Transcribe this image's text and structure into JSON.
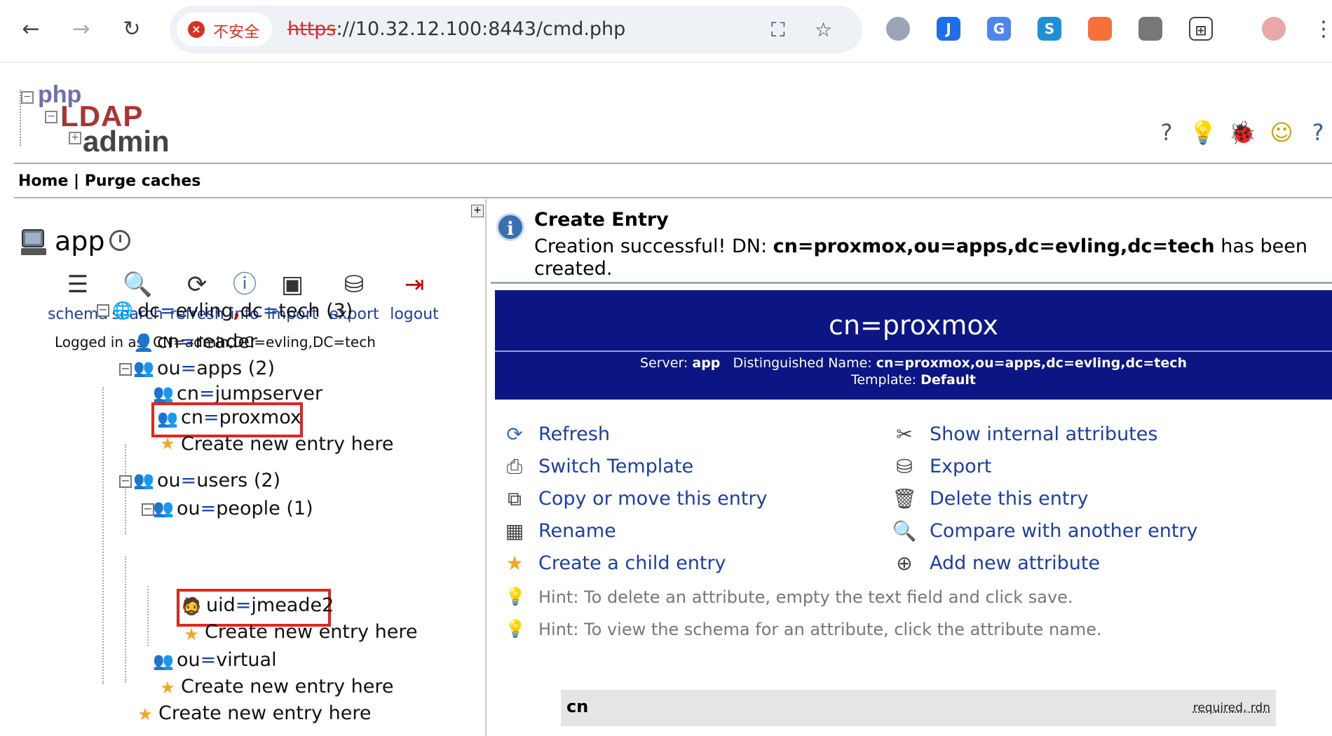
{
  "browser": {
    "insecure_label": "不安全",
    "url_scheme": "https",
    "url_rest": "://10.32.12.100:8443/cmd.php"
  },
  "header": {
    "logo_php": "php",
    "logo_ldap": "LDAP",
    "logo_admin": "admin",
    "home": "Home",
    "separator": "|",
    "purge": "Purge caches"
  },
  "sidebar": {
    "server": "app",
    "tools": [
      "schema",
      "search",
      "refresh",
      "info",
      "import",
      "export",
      "logout"
    ],
    "logged_in": "Logged in as: CN=admin,DC=evling,DC=tech",
    "tree": {
      "root": {
        "a": "dc",
        "b": "evling",
        "c": "dc",
        "d": "tech",
        "count": "(3)"
      },
      "reader": {
        "k": "cn",
        "v": "reader"
      },
      "apps": {
        "k": "ou",
        "v": "apps",
        "count": "(2)"
      },
      "jumpserver": {
        "k": "cn",
        "v": "jumpserver"
      },
      "proxmox": {
        "k": "cn",
        "v": "proxmox"
      },
      "create": "Create new entry here",
      "users": {
        "k": "ou",
        "v": "users",
        "count": "(2)"
      },
      "people": {
        "k": "ou",
        "v": "people",
        "count": "(1)"
      },
      "jmeade": {
        "k": "uid",
        "v": "jmeade2"
      },
      "virtual": {
        "k": "ou",
        "v": "virtual"
      }
    }
  },
  "main": {
    "title": "Create Entry",
    "msg_prefix": "Creation successful! DN: ",
    "msg_dn": "cn=proxmox,ou=apps,dc=evling,dc=tech",
    "msg_suffix": " has been created.",
    "banner_rdn": "cn=proxmox",
    "server_label": "Server: ",
    "server_value": "app",
    "dn_label": "Distinguished Name: ",
    "dn_value": "cn=proxmox,ou=apps,dc=evling,dc=tech",
    "template_label": "Template: ",
    "template_value": "Default",
    "actions_left": [
      "Refresh",
      "Switch Template",
      "Copy or move this entry",
      "Rename",
      "Create a child entry"
    ],
    "actions_right": [
      "Show internal attributes",
      "Export",
      "Delete this entry",
      "Compare with another entry",
      "Add new attribute"
    ],
    "hints": [
      "Hint: To delete an attribute, empty the text field and click save.",
      "Hint: To view the schema for an attribute, click the attribute name."
    ],
    "attr_name": "cn",
    "attr_flags": "required, rdn"
  },
  "colors": {
    "accent": "#0c1584",
    "link": "#1a3fa6",
    "highlight": "#e0261e",
    "insecure": "#d93025"
  }
}
